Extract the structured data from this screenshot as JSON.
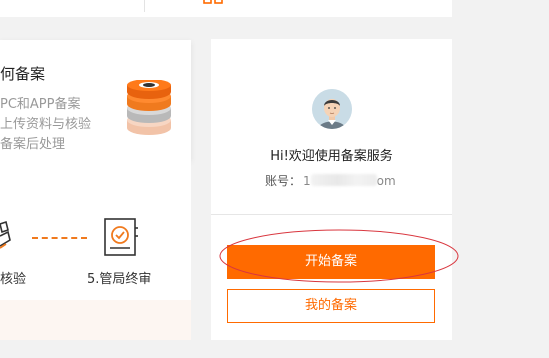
{
  "left": {
    "title": "何备案",
    "lines": [
      "PC和APP备案",
      "上传资料与核验",
      "备案后处理"
    ],
    "steps": {
      "partial_label": "核验",
      "step5_label": "5.管局终审"
    }
  },
  "right": {
    "welcome": "Hi!欢迎使用备案服务",
    "account_label": "账号：",
    "account_value_start": "1",
    "account_value_end": "om",
    "start_button": "开始备案",
    "my_button": "我的备案"
  },
  "icons": {
    "top": "grid-icon",
    "stack": "server-stack-icon",
    "step4": "verify-icon",
    "step5": "certificate-icon",
    "avatar": "user-avatar-icon"
  },
  "colors": {
    "accent": "#ff6a00",
    "highlight": "#d9363e"
  }
}
